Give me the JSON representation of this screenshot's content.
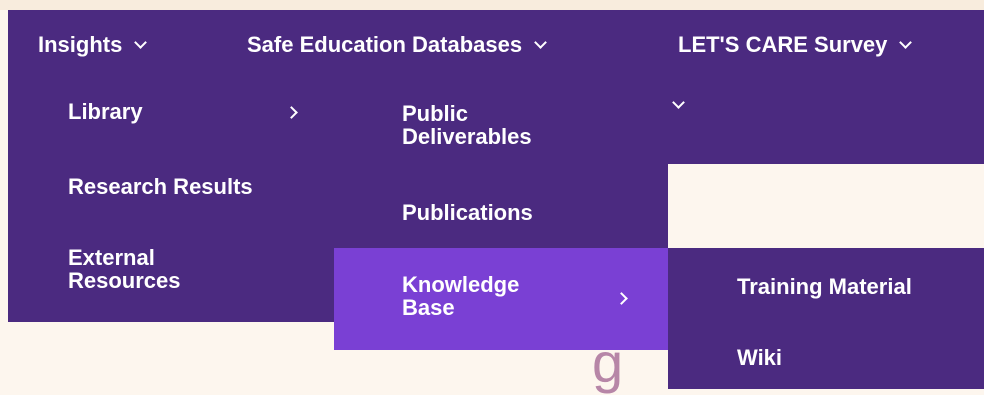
{
  "topnav": {
    "items": [
      {
        "label": "Insights"
      },
      {
        "label": "Safe Education Databases"
      },
      {
        "label": "LET'S CARE Survey"
      }
    ]
  },
  "menu_level1": {
    "items": [
      {
        "label_lines": [
          "Library"
        ]
      },
      {
        "label_lines": [
          "Research Results"
        ]
      },
      {
        "label_lines": [
          "External",
          "Resources"
        ]
      }
    ]
  },
  "menu_level2": {
    "items": [
      {
        "label_lines": [
          "Public",
          "Deliverables"
        ]
      },
      {
        "label_lines": [
          "Publications"
        ]
      },
      {
        "label_lines": [
          "Knowledge",
          "Base"
        ]
      }
    ]
  },
  "menu_level3": {
    "items": [
      {
        "label": "Training Material"
      },
      {
        "label": "Wiki"
      }
    ]
  },
  "background": {
    "partial_heading_fragment": "g"
  },
  "colors": {
    "menu_bg": "#4b2a80",
    "menu_active_bg": "#7a40d4",
    "page_bg": "#fdf6ee",
    "text": "#ffffff"
  }
}
